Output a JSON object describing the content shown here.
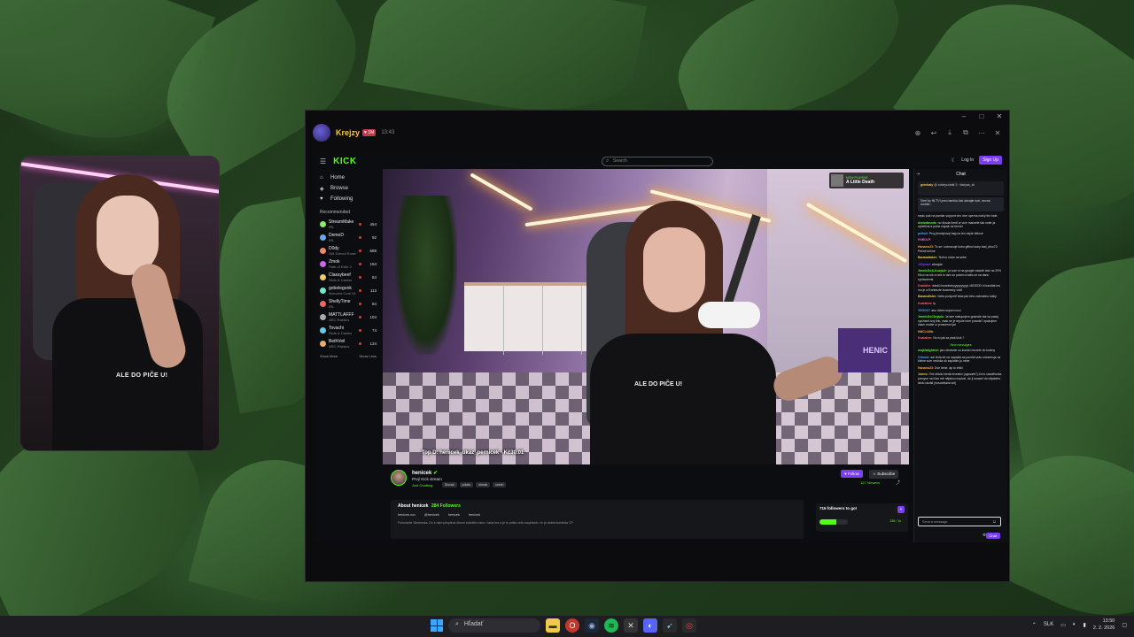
{
  "window": {
    "controls": [
      "–",
      "□",
      "✕"
    ]
  },
  "app_header": {
    "channel_name": "Krejzy",
    "time": "13:43",
    "tools": [
      "zoom-in",
      "back",
      "download",
      "external",
      "more",
      "close"
    ]
  },
  "kick": {
    "logo": "KICK",
    "search_placeholder": "Search",
    "login": "Log In",
    "signup": "Sign Up",
    "nav": [
      {
        "label": "Home",
        "icon": "⌂"
      },
      {
        "label": "Browse",
        "icon": "◈"
      },
      {
        "label": "Following",
        "icon": "♥"
      }
    ],
    "recommended_title": "Recommended",
    "recommended": [
      {
        "name": "StreamMake",
        "cat": "IRL",
        "viewers": "454"
      },
      {
        "name": "DemoD",
        "cat": "IRL",
        "viewers": "92"
      },
      {
        "name": "D0dy",
        "cat": "Old School RuneScape",
        "viewers": "588"
      },
      {
        "name": "Zmok",
        "cat": "Path of Exile 2",
        "viewers": "184"
      },
      {
        "name": "Classybeef",
        "cat": "Slots & Casino",
        "viewers": "84"
      },
      {
        "name": "gobelegonk",
        "cat": "Armored Core VI: Fires...",
        "viewers": "113"
      },
      {
        "name": "ShellyTime",
        "cat": "IRL",
        "viewers": "84"
      },
      {
        "name": "MATTLAFFF",
        "cat": "ARC Raiders",
        "viewers": "104"
      },
      {
        "name": "Tovachi",
        "cat": "Slots & Casino",
        "viewers": "74"
      },
      {
        "name": "BethVeil",
        "cat": "ARC Raiders",
        "viewers": "134"
      }
    ],
    "show_more": "Show More",
    "show_less": "Show Less"
  },
  "video": {
    "overlay_label": "NOW PLAYING",
    "overlay_title": "A Little Death",
    "donation_text": "Top D: henicek_ukaz_pernicek - Kč30.01",
    "shirt_text": "ALE DO PIČE U!",
    "sofa_text": "HENIC"
  },
  "stream": {
    "name": "henicek",
    "title": "Prvý Kick stream",
    "category": "Just Chatting",
    "tags": [
      "Slovak",
      "potato",
      "slovak",
      "czech"
    ],
    "follow": "Follow",
    "subscribe": "Subscribe",
    "viewers": "127 Viewers"
  },
  "about": {
    "title": "About henicek",
    "followers": "284 Followers",
    "links": [
      "henicek.xxx",
      "@henicek",
      "henicek",
      "henicek"
    ],
    "description": "Počúvanie Slovenska. Do k nám prispieva denne každého ráno • tada hra a je to prišlá veľa rozprávok • to je dobrá komédia CP"
  },
  "goal": {
    "title": "715 followers to go!",
    "progress": 0.6,
    "count": "285 / 1k"
  },
  "chat": {
    "title": "Chat",
    "pinned_user": "gembaly",
    "pinned_text": "@ codeycobalt 3 · dariyas_zk",
    "banner": "Sent by fili.TV! preo tamika čak dávajte sub, nezna mobile...",
    "messages": [
      {
        "user": "",
        "text": "sepiu pak na pamiar support cim vice operna nobly tim bale.",
        "color": "#ddd"
      },
      {
        "user": "deniwiknods:",
        "text": "no škoda hentl ur více manzele tak noter ja nybetival a poine napak na hectm",
        "color": "#53fc18"
      },
      {
        "user": "petka3:",
        "text": "Prvy jiemejrosqi bag na ten nejde klikout",
        "color": "#4da3ff"
      },
      {
        "user": "HXBOLP:",
        "text": "",
        "color": "#ff5fd1"
      },
      {
        "user": "Hanama23:",
        "text": "To se i zobrazuje koho giftnul suby bad_dino72: Pekné krične",
        "color": "#ff9f43"
      },
      {
        "user": "Barawaltaker:",
        "text": "Ted ho mám na sebe",
        "color": "#f2c94c"
      },
      {
        "user": "Jitkjmad:",
        "text": "ahoojde",
        "color": "#7b3ff2"
      },
      {
        "user": "JarmicDoAJLozjaJe:",
        "text": "ja som si na google vaaziel tato na 20% Kiku! na tok a ned to tam so potom a tabs ze na danu spröwnenst",
        "color": "#53fc18"
      },
      {
        "user": "Koalathe:",
        "text": "daskü lozantomyyyyyyyyyy xDDDDD hi kandiat mo mu je a Exeleszte lozametry xddf",
        "color": "#ff5f5f"
      },
      {
        "user": "Bananafluke:",
        "text": "Nebo podporiť teba jak toho zabrostnu kolký",
        "color": "#f2c94c"
      },
      {
        "user": "Koalatina:",
        "text": "ty",
        "color": "#ff5f5f"
      },
      {
        "user": "YEGOLT:",
        "text": "ako dobre sspon noco",
        "color": "#4da3ff"
      },
      {
        "user": "JarmicDoChejado:",
        "text": "Ja tam nakupujem gramote tak sa pasuj využisnit tvoj link, vsak ne je tepule mne pravda? opakujem vsam mobie ui proscenni ijai",
        "color": "#53fc18"
      },
      {
        "user": "HMCLLWb:",
        "text": "",
        "color": "#ff9f43"
      },
      {
        "user": "Koalatme:",
        "text": "No to jak sa platí kick ?",
        "color": "#ff5f5f"
      },
      {
        "user": "mojklakghtest:",
        "text": "jaro dostanie so kuchin muzete do koleny",
        "color": "#53fc18"
      },
      {
        "user": "Chbwst:",
        "text": "aa! teda de na napadla sa pozriat vráu smoemuje za kleine som nedoka ok zaplatim ju nebe",
        "color": "#4da3ff"
      },
      {
        "user": "Hanama23:",
        "text": "Dve letné. áp to ehlki",
        "color": "#ff9f43"
      },
      {
        "user": "Jurevz:",
        "text": "Ted někdo hledá investici (uppsale?) Za to vazdětovka prevyce na Kice mě nějakou explosi, do ji mussel do nějakého dedo ukzáli (nosovětaná lcit)",
        "color": "#f2c94c"
      }
    ],
    "new_messages": "New messages",
    "input_placeholder": "Send a message",
    "send": "Chat"
  },
  "taskbar": {
    "search": "Hľadať",
    "lang": "SLK",
    "time": "13:50",
    "date": "2. 2. 2026"
  }
}
